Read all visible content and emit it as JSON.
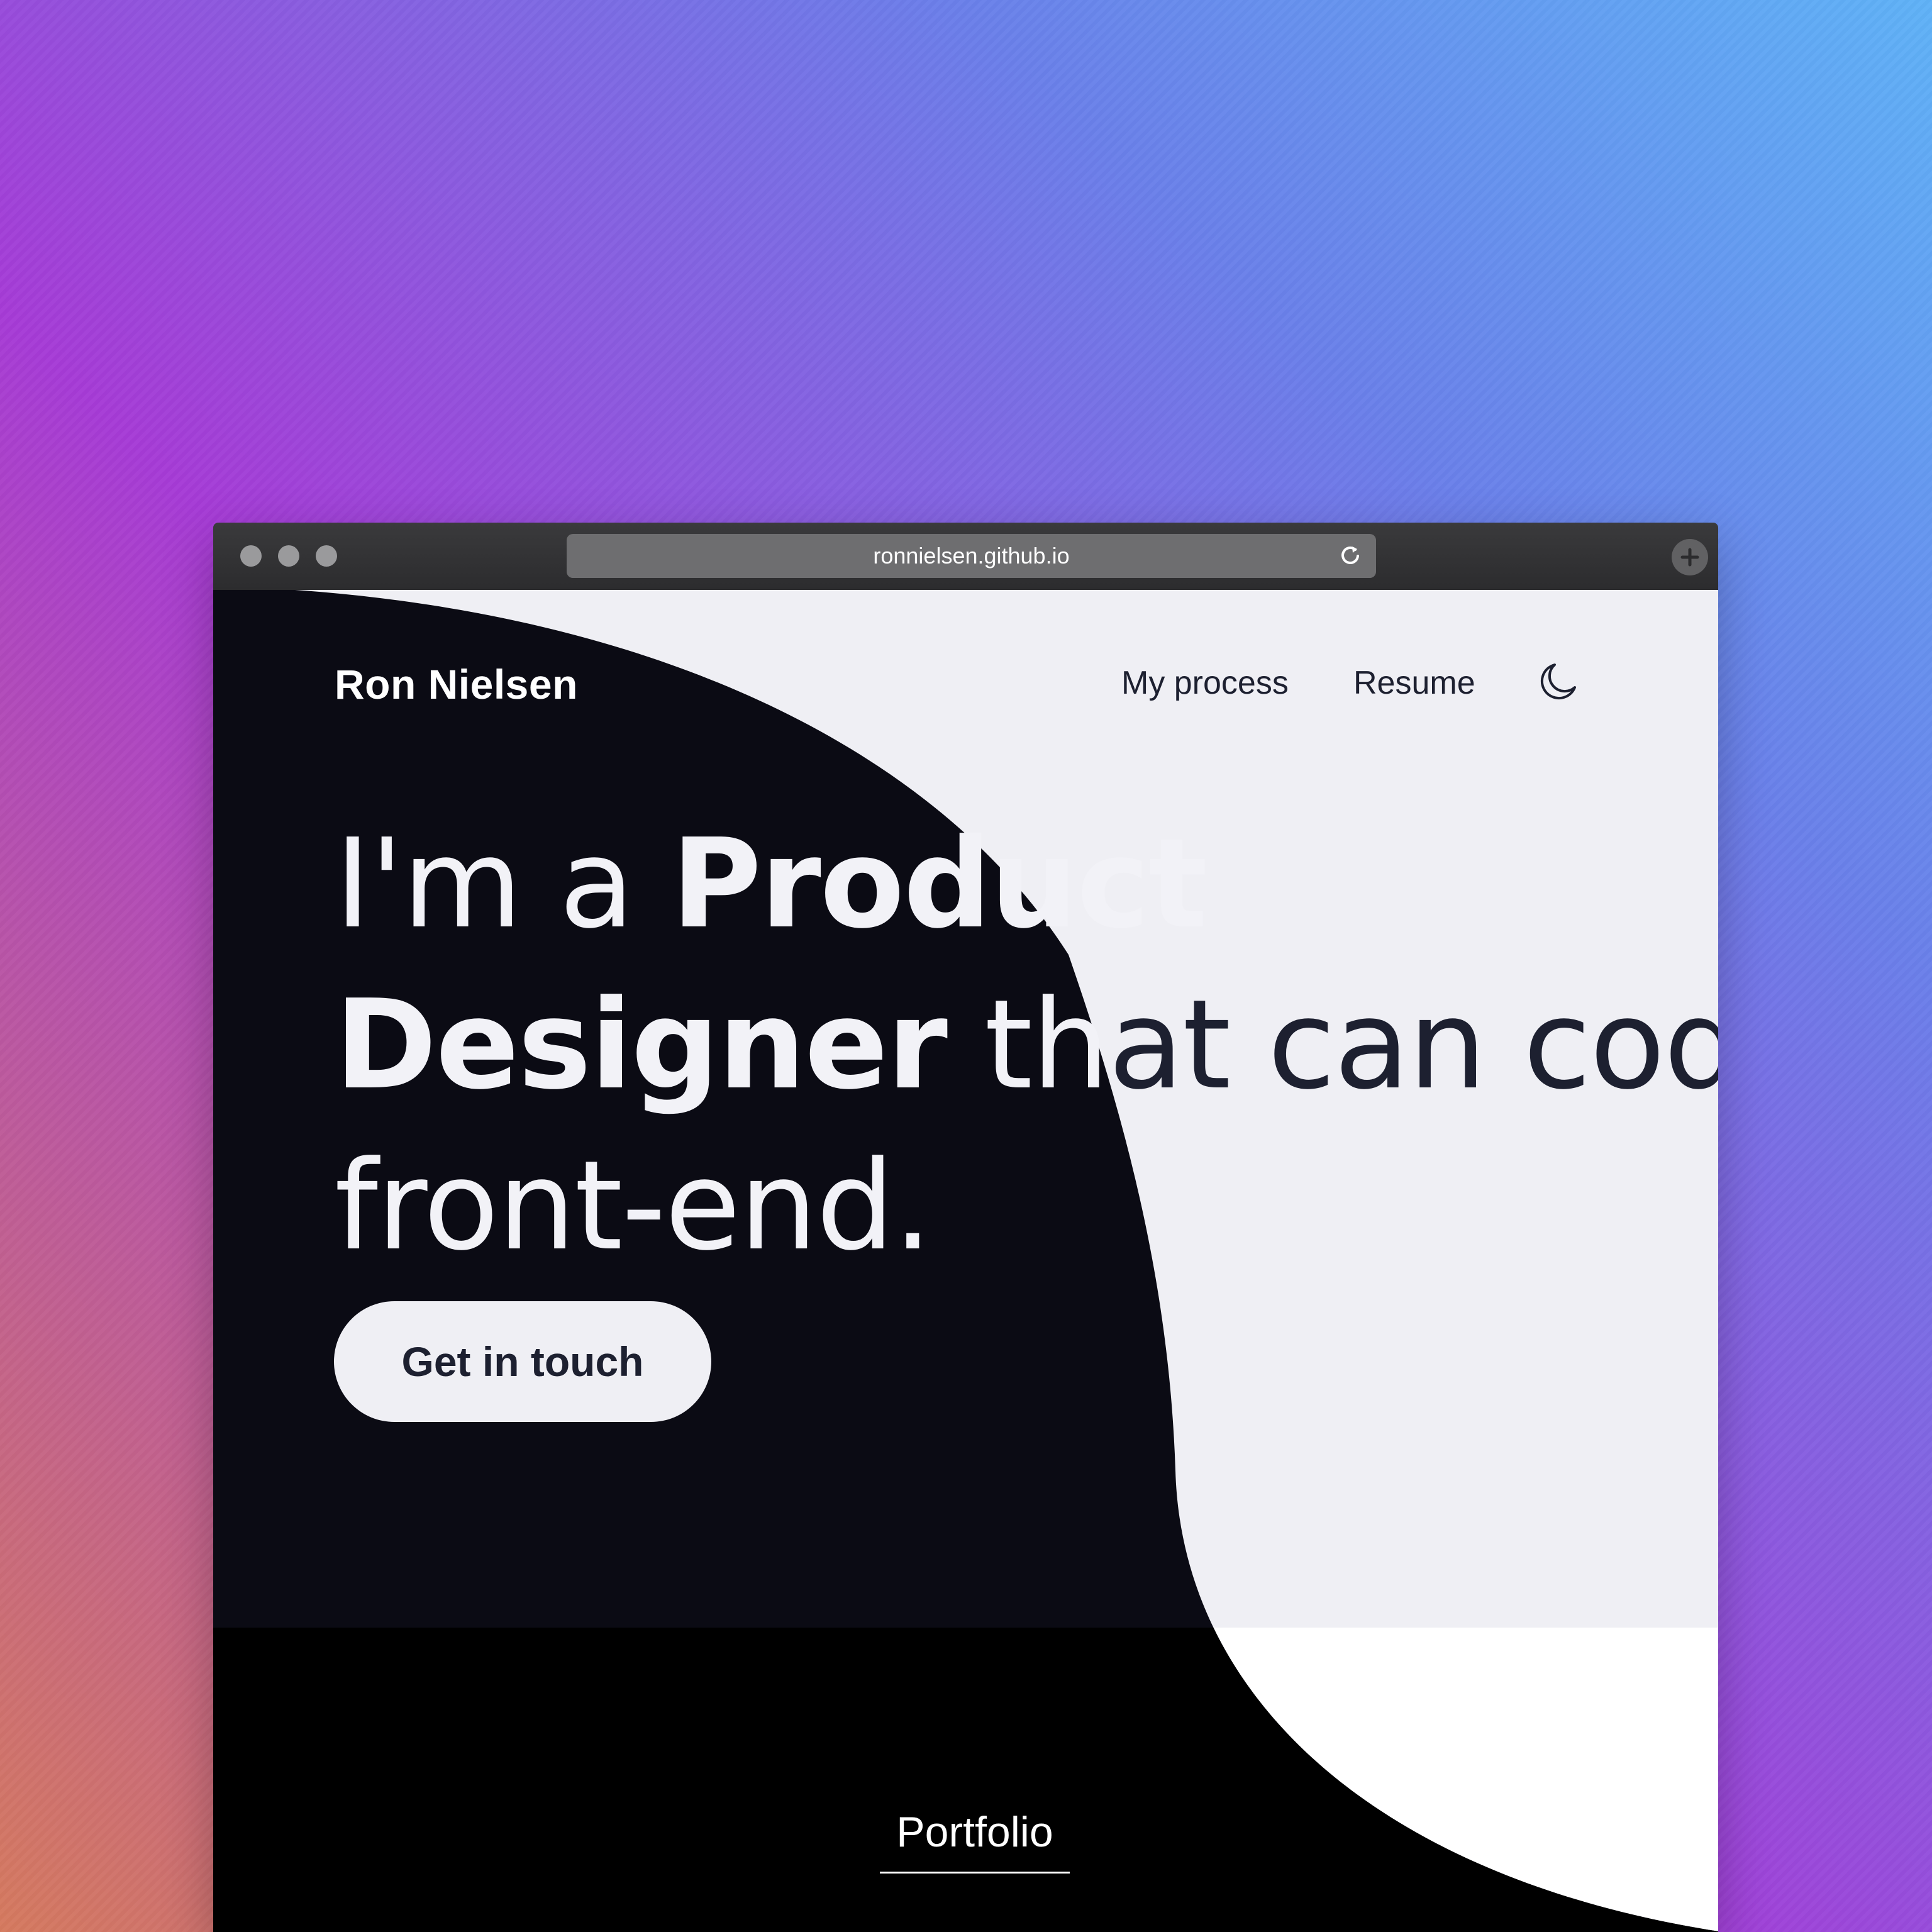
{
  "browser": {
    "url": "ronnielsen.github.io",
    "icons": [
      "reload-icon",
      "new-tab-plus-icon"
    ]
  },
  "site": {
    "logo": "Ron Nielsen",
    "nav": {
      "process": "My process",
      "resume": "Resume",
      "theme_icon": "moon-icon"
    },
    "hero": {
      "part1": "I'm a ",
      "part2": "Product",
      "part3": "Designer",
      "part4": " th",
      "part5": "at can code",
      "part6": "front-end."
    },
    "cta": "Get in touch",
    "portfolio": "Portfolio"
  },
  "colors": {
    "dark": "#0b0b14",
    "light": "#efeff4",
    "text_dark": "#1d2030",
    "text_light": "#f2f2f7"
  }
}
